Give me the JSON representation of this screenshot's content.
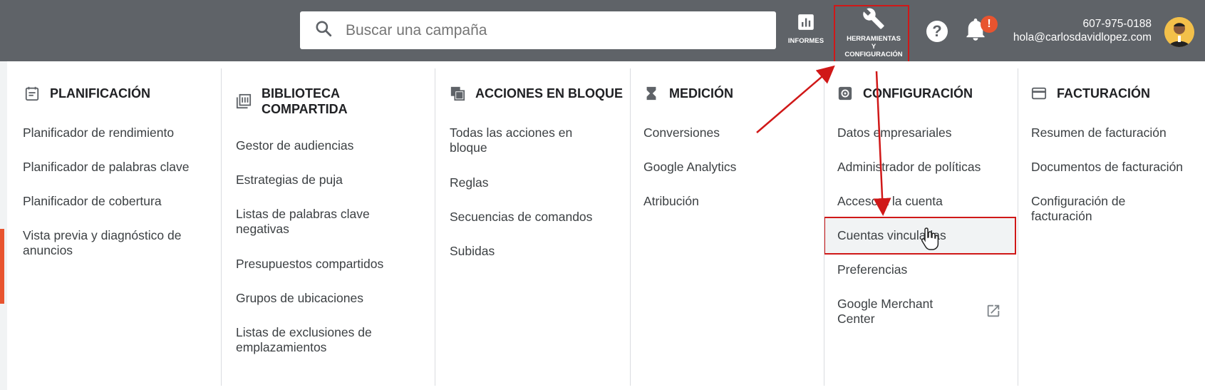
{
  "search": {
    "placeholder": "Buscar una campaña"
  },
  "toolbar": {
    "reports_label": "INFORMES",
    "tools_label_line1": "HERRAMIENTAS",
    "tools_label_line2": "Y",
    "tools_label_line3": "CONFIGURACIÓN",
    "notification_badge": "!",
    "help_label": "?"
  },
  "account": {
    "phone": "607-975-0188",
    "email": "hola@carlosdavidlopez.com"
  },
  "menu": {
    "planificacion": {
      "title": "PLANIFICACIÓN",
      "items": [
        "Planificador de rendimiento",
        "Planificador de palabras clave",
        "Planificador de cobertura",
        "Vista previa y diagnóstico de anuncios"
      ]
    },
    "biblioteca": {
      "title_line1": "BIBLIOTECA",
      "title_line2": "COMPARTIDA",
      "items": [
        "Gestor de audiencias",
        "Estrategias de puja",
        "Listas de palabras clave negativas",
        "Presupuestos compartidos",
        "Grupos de ubicaciones",
        "Listas de exclusiones de emplazamientos"
      ]
    },
    "acciones": {
      "title": "ACCIONES EN BLOQUE",
      "items": [
        "Todas las acciones en bloque",
        "Reglas",
        "Secuencias de comandos",
        "Subidas"
      ]
    },
    "medicion": {
      "title": "MEDICIÓN",
      "items": [
        "Conversiones",
        "Google Analytics",
        "Atribución"
      ]
    },
    "configuracion": {
      "title": "CONFIGURACIÓN",
      "items": [
        "Datos empresariales",
        "Administrador de políticas",
        "Acceso a la cuenta",
        "Cuentas vinculadas",
        "Preferencias",
        "Google Merchant Center"
      ]
    },
    "facturacion": {
      "title": "FACTURACIÓN",
      "items": [
        "Resumen de facturación",
        "Documentos de facturación",
        "Configuración de facturación"
      ]
    }
  },
  "icons": {
    "search": "search-icon",
    "reports": "bar-chart-icon",
    "tools": "wrench-icon",
    "help": "help-icon",
    "notifications": "bell-icon",
    "external": "open-in-new-icon"
  },
  "colors": {
    "topbar": "#5f6368",
    "highlight": "#d01818",
    "badge": "#e8542f"
  }
}
